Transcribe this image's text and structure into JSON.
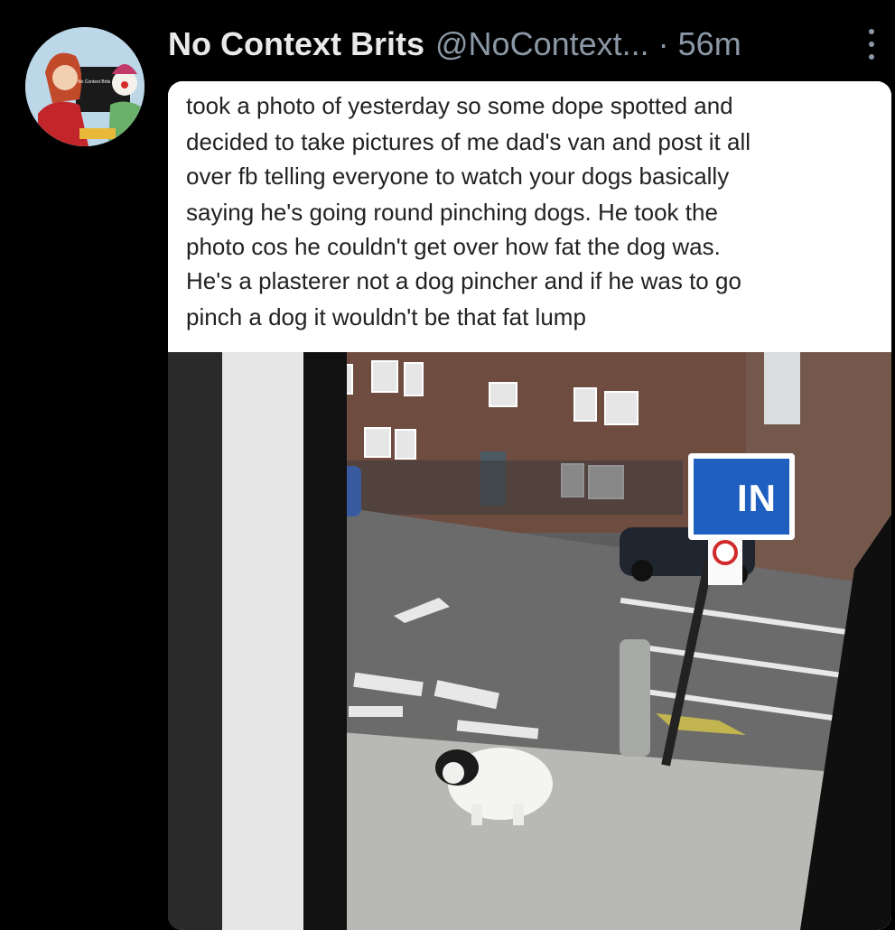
{
  "tweet": {
    "author_name": "No Context Brits",
    "author_handle": "@NoContext...",
    "separator": "·",
    "time": "56m",
    "avatar_caption": "No Context Brits",
    "menu_icon": "more-vertical-icon"
  },
  "media": {
    "caption_lines": [
      "took a photo of yesterday so some dope spotted and",
      "decided to take pictures of me dad's van and post it all",
      "over fb telling everyone to watch your dogs basically",
      "saying he's going round pinching dogs. He took the",
      "photo cos he couldn't get over how fat the dog was.",
      "He's a plasterer not a dog pincher and if he was to go",
      "pinch a dog it wouldn't be that fat lump"
    ],
    "sign_text": "IN",
    "colors": {
      "sign_blue": "#1e5fbf",
      "brick": "#6b4a3e",
      "asphalt": "#6e6e6e"
    }
  }
}
